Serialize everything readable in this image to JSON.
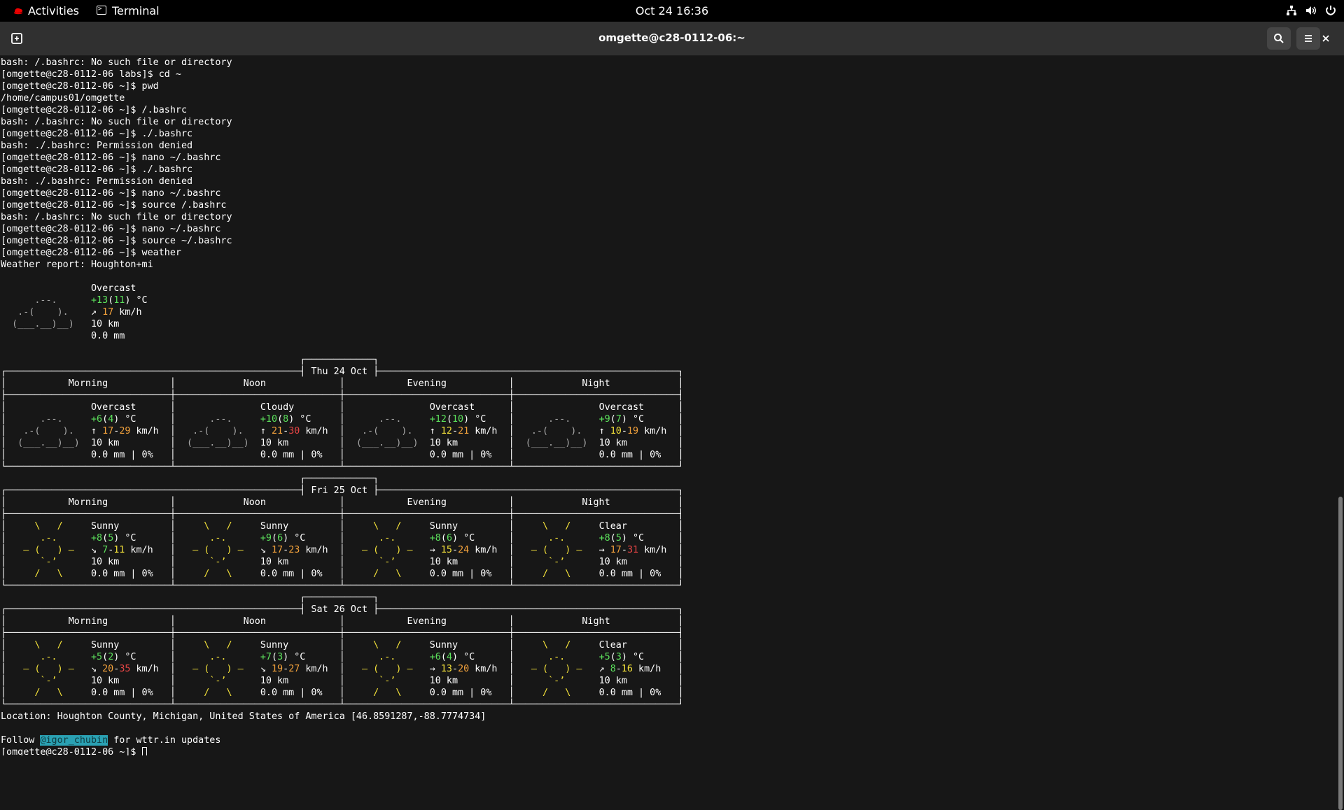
{
  "topbar": {
    "activities": "Activities",
    "app_name": "Terminal",
    "clock": "Oct 24  16:36"
  },
  "window": {
    "title": "omgette@c28-0112-06:~"
  },
  "colors": {
    "terminal_bg": "#171717",
    "header_bg": "#303030",
    "topbar_bg": "#000000",
    "selection": "#2aa1b3",
    "yellow": "#f4e23a",
    "green": "#5ce25c",
    "orange": "#f3a23c",
    "red": "#e84545"
  },
  "icons": {
    "topbar": [
      "redhat-logo-icon",
      "terminal-app-icon",
      "network-icon",
      "volume-icon",
      "power-icon"
    ],
    "header": [
      "new-tab-icon",
      "search-icon",
      "hamburger-menu-icon",
      "close-icon"
    ]
  },
  "terminal": {
    "history": [
      "bash: /.bashrc: No such file or directory",
      "[omgette@c28-0112-06 labs]$ cd ~",
      "[omgette@c28-0112-06 ~]$ pwd",
      "/home/campus01/omgette",
      "[omgette@c28-0112-06 ~]$ /.bashrc",
      "bash: /.bashrc: No such file or directory",
      "[omgette@c28-0112-06 ~]$ ./.bashrc",
      "bash: ./.bashrc: Permission denied",
      "[omgette@c28-0112-06 ~]$ nano ~/.bashrc",
      "[omgette@c28-0112-06 ~]$ ./.bashrc",
      "bash: ./.bashrc: Permission denied",
      "[omgette@c28-0112-06 ~]$ nano ~/.bashrc",
      "[omgette@c28-0112-06 ~]$ source /.bashrc",
      "bash: /.bashrc: No such file or directory",
      "[omgette@c28-0112-06 ~]$ nano ~/.bashrc",
      "[omgette@c28-0112-06 ~]$ source ~/.bashrc",
      "[omgette@c28-0112-06 ~]$ weather"
    ],
    "report_header": "Weather report: Houghton+mi",
    "current": {
      "condition": "Overcast",
      "temp": "+13",
      "feels": "11",
      "temp_unit": "°C",
      "wind_arrow": "↗",
      "wind": "17",
      "wind_unit": "km/h",
      "visibility": "10 km",
      "precip": "0.0 mm"
    },
    "periods": [
      "Morning",
      "Noon",
      "Evening",
      "Night"
    ],
    "days": [
      {
        "label": "Thu 24 Oct",
        "cells": [
          {
            "icon": "cloud",
            "condition": "Overcast",
            "temp": "+6",
            "feels": "4",
            "arrow": "↑",
            "wmin": "17",
            "wmax": "29",
            "vis": "10 km",
            "precip": "0.0 mm | 0%"
          },
          {
            "icon": "cloud",
            "condition": "Cloudy",
            "temp": "+10",
            "feels": "8",
            "arrow": "↑",
            "wmin": "21",
            "wmax": "30",
            "vis": "10 km",
            "precip": "0.0 mm | 0%"
          },
          {
            "icon": "cloud",
            "condition": "Overcast",
            "temp": "+12",
            "feels": "10",
            "arrow": "↑",
            "wmin": "12",
            "wmax": "21",
            "vis": "10 km",
            "precip": "0.0 mm | 0%"
          },
          {
            "icon": "cloud",
            "condition": "Overcast",
            "temp": "+9",
            "feels": "7",
            "arrow": "↑",
            "wmin": "10",
            "wmax": "19",
            "vis": "10 km",
            "precip": "0.0 mm | 0%"
          }
        ]
      },
      {
        "label": "Fri 25 Oct",
        "cells": [
          {
            "icon": "sun",
            "condition": "Sunny",
            "temp": "+8",
            "feels": "5",
            "arrow": "↘",
            "wmin": "7",
            "wmax": "11",
            "vis": "10 km",
            "precip": "0.0 mm | 0%"
          },
          {
            "icon": "sun",
            "condition": "Sunny",
            "temp": "+9",
            "feels": "6",
            "arrow": "↘",
            "wmin": "17",
            "wmax": "23",
            "vis": "10 km",
            "precip": "0.0 mm | 0%"
          },
          {
            "icon": "sun",
            "condition": "Sunny",
            "temp": "+8",
            "feels": "6",
            "arrow": "→",
            "wmin": "15",
            "wmax": "24",
            "vis": "10 km",
            "precip": "0.0 mm | 0%"
          },
          {
            "icon": "sun",
            "condition": "Clear",
            "temp": "+8",
            "feels": "5",
            "arrow": "→",
            "wmin": "17",
            "wmax": "31",
            "vis": "10 km",
            "precip": "0.0 mm | 0%"
          }
        ]
      },
      {
        "label": "Sat 26 Oct",
        "cells": [
          {
            "icon": "sun",
            "condition": "Sunny",
            "temp": "+5",
            "feels": "2",
            "arrow": "↘",
            "wmin": "20",
            "wmax": "35",
            "vis": "10 km",
            "precip": "0.0 mm | 0%"
          },
          {
            "icon": "sun",
            "condition": "Sunny",
            "temp": "+7",
            "feels": "3",
            "arrow": "↘",
            "wmin": "19",
            "wmax": "27",
            "vis": "10 km",
            "precip": "0.0 mm | 0%"
          },
          {
            "icon": "sun",
            "condition": "Sunny",
            "temp": "+6",
            "feels": "4",
            "arrow": "→",
            "wmin": "13",
            "wmax": "20",
            "vis": "10 km",
            "precip": "0.0 mm | 0%"
          },
          {
            "icon": "sun",
            "condition": "Clear",
            "temp": "+5",
            "feels": "3",
            "arrow": "↗",
            "wmin": "8",
            "wmax": "16",
            "vis": "10 km",
            "precip": "0.0 mm | 0%"
          }
        ]
      }
    ],
    "location": "Location: Houghton County, Michigan, United States of America [46.8591287,-88.7774734]",
    "follow_prefix": "Follow ",
    "follow_handle": "@igor_chubin",
    "follow_suffix": " for wttr.in updates",
    "prompt": "[omgette@c28-0112-06 ~]$ "
  }
}
